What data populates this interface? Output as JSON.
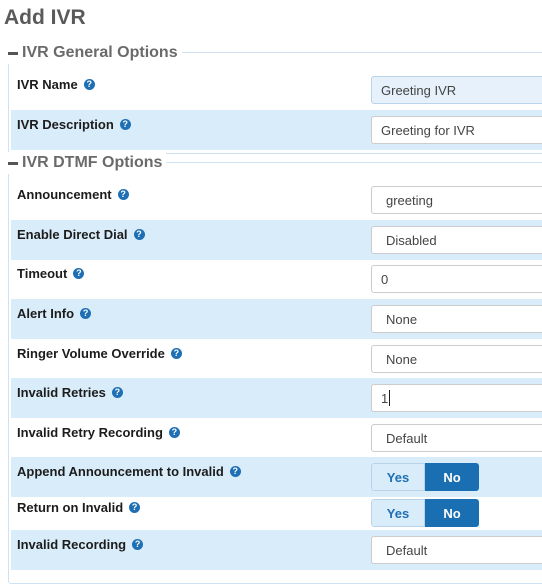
{
  "page": {
    "title": "Add IVR"
  },
  "general": {
    "title": "IVR General Options",
    "ivr_name": {
      "label": "IVR Name",
      "value": "Greeting IVR"
    },
    "ivr_description": {
      "label": "IVR Description",
      "value": "Greeting for IVR"
    }
  },
  "dtmf": {
    "title": "IVR DTMF Options",
    "announcement": {
      "label": "Announcement",
      "value": "greeting"
    },
    "enable_direct_dial": {
      "label": "Enable Direct Dial",
      "value": "Disabled"
    },
    "timeout": {
      "label": "Timeout",
      "value": "0"
    },
    "alert_info": {
      "label": "Alert Info",
      "value": "None"
    },
    "ringer_volume_override": {
      "label": "Ringer Volume Override",
      "value": "None"
    },
    "invalid_retries": {
      "label": "Invalid Retries",
      "value": "1"
    },
    "invalid_retry_recording": {
      "label": "Invalid Retry Recording",
      "value": "Default"
    },
    "append_announcement_to_invalid": {
      "label": "Append Announcement to Invalid",
      "yes": "Yes",
      "no": "No",
      "selected": "No"
    },
    "return_on_invalid": {
      "label": "Return on Invalid",
      "yes": "Yes",
      "no": "No",
      "selected": "No"
    },
    "invalid_recording": {
      "label": "Invalid Recording",
      "value": "Default"
    }
  },
  "icons": {
    "help": "?"
  },
  "colors": {
    "accent": "#1a6fb2",
    "row_alt": "#d9ecf9",
    "toggle_off": "#d9ecf9"
  }
}
